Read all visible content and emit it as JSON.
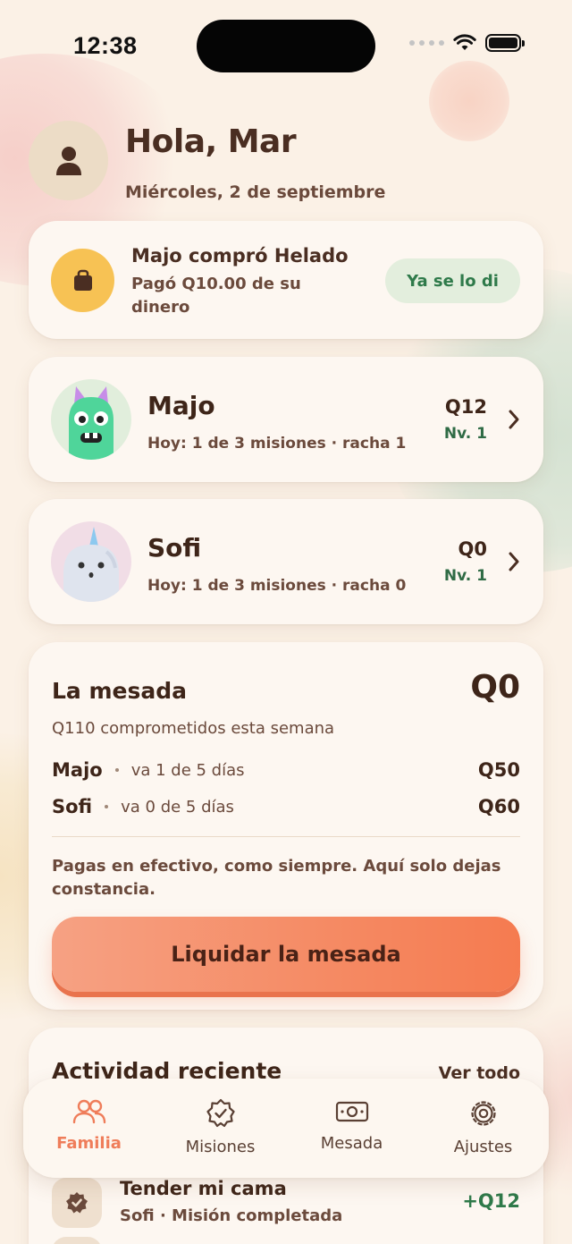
{
  "status_bar": {
    "time": "12:38"
  },
  "header": {
    "greeting": "Hola, Mar",
    "date": "Miércoles, 2 de septiembre"
  },
  "notification": {
    "title": "Majo compró Helado",
    "subtitle": "Pagó Q10.00 de su dinero",
    "action_label": "Ya se lo di",
    "icon": "shopping-bag-icon"
  },
  "kids": [
    {
      "name": "Majo",
      "today": "Hoy: 1 de 3 misiones · racha 1",
      "amount": "Q12",
      "level": "Nv. 1",
      "avatar": "green-monster-avatar"
    },
    {
      "name": "Sofi",
      "today": "Hoy: 1 de 3 misiones · racha 0",
      "amount": "Q0",
      "level": "Nv. 1",
      "avatar": "unicorn-avatar"
    }
  ],
  "allowance": {
    "title": "La mesada",
    "total": "Q0",
    "committed": "Q110 comprometidos esta semana",
    "rows": [
      {
        "name": "Majo",
        "progress": "va 1 de 5 días",
        "amount": "Q50"
      },
      {
        "name": "Sofi",
        "progress": "va 0 de 5 días",
        "amount": "Q60"
      }
    ],
    "note": "Pagas en efectivo, como siempre. Aquí solo dejas constancia.",
    "cta_label": "Liquidar la mesada"
  },
  "activity": {
    "title": "Actividad reciente",
    "see_all": "Ver todo",
    "items": [
      {
        "title": "Tender mi cama",
        "subtitle": "Sofi · Misión completada",
        "points": "+Q12",
        "icon": "check-badge-icon"
      }
    ]
  },
  "tabbar": {
    "tabs": [
      {
        "label": "Familia",
        "icon": "people-icon",
        "active": true
      },
      {
        "label": "Misiones",
        "icon": "badge-check-icon",
        "active": false
      },
      {
        "label": "Mesada",
        "icon": "banknote-icon",
        "active": false
      },
      {
        "label": "Ajustes",
        "icon": "gear-icon",
        "active": false
      }
    ]
  },
  "colors": {
    "background": "#fbf1e6",
    "accent": "#ef7d5a",
    "positive": "#2f7a4a",
    "text_primary": "#3e2519"
  }
}
